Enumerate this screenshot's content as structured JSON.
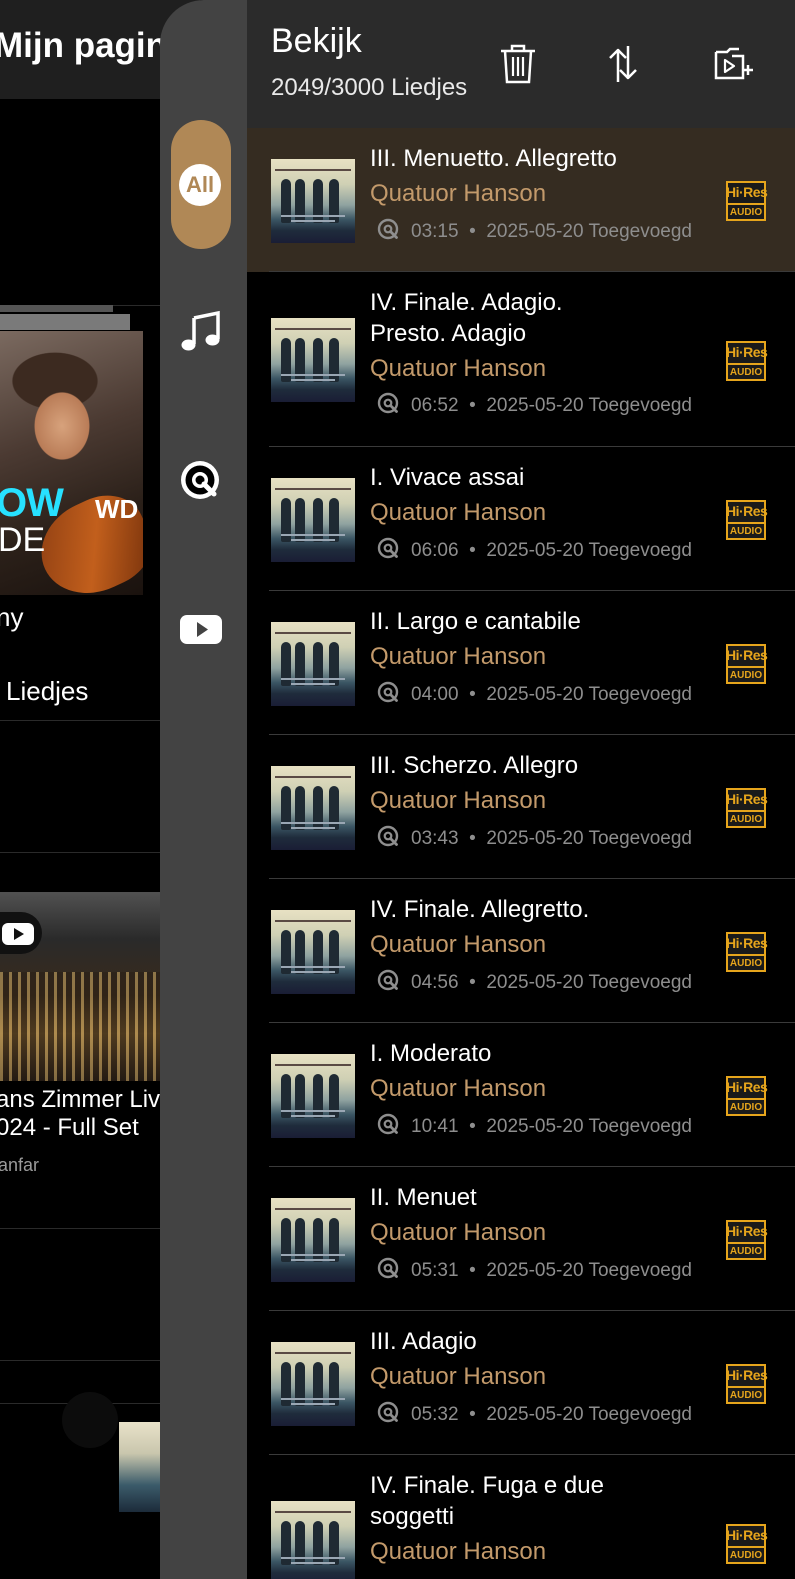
{
  "background_page": {
    "title": "Mijn pagina",
    "cover_text_1": "OW",
    "cover_text_2": "WD",
    "cover_text_3": "DE",
    "label_1": "ny",
    "label_2": "Liedjes",
    "video_title_line1": "ans Zimmer Liv",
    "video_title_line2": "024 - Full Set",
    "video_channel": "anfar"
  },
  "sidebar": {
    "filters": [
      {
        "label": "All",
        "icon": "all-icon"
      },
      {
        "icon": "music-note-icon"
      },
      {
        "icon": "qobuz-icon"
      },
      {
        "icon": "youtube-icon"
      }
    ],
    "selected": "All"
  },
  "panel": {
    "title": "Bekijk",
    "count": "2049/3000 Liedjes",
    "toolbar": [
      "trash-icon",
      "sort-icon",
      "add-to-playlist-icon"
    ],
    "badge": {
      "top": "Hi·Res",
      "bottom": "AUDIO",
      "color": "#e6a51c"
    },
    "accent": "#c39a6b",
    "tracks": [
      {
        "title": "III. Menuetto. Allegretto",
        "artist": "Quatuor Hanson",
        "duration": "03:15",
        "added": "2025-05-20 Toegevoegd"
      },
      {
        "title": "IV. Finale. Adagio. Presto. Adagio",
        "artist": "Quatuor Hanson",
        "duration": "06:52",
        "added": "2025-05-20 Toegevoegd"
      },
      {
        "title": "I. Vivace assai",
        "artist": "Quatuor Hanson",
        "duration": "06:06",
        "added": "2025-05-20 Toegevoegd"
      },
      {
        "title": "II. Largo e cantabile",
        "artist": "Quatuor Hanson",
        "duration": "04:00",
        "added": "2025-05-20 Toegevoegd"
      },
      {
        "title": "III. Scherzo. Allegro",
        "artist": "Quatuor Hanson",
        "duration": "03:43",
        "added": "2025-05-20 Toegevoegd"
      },
      {
        "title": "IV. Finale. Allegretto.",
        "artist": "Quatuor Hanson",
        "duration": "04:56",
        "added": "2025-05-20 Toegevoegd"
      },
      {
        "title": "I. Moderato",
        "artist": "Quatuor Hanson",
        "duration": "10:41",
        "added": "2025-05-20 Toegevoegd"
      },
      {
        "title": "II. Menuet",
        "artist": "Quatuor Hanson",
        "duration": "05:31",
        "added": "2025-05-20 Toegevoegd"
      },
      {
        "title": "III. Adagio",
        "artist": "Quatuor Hanson",
        "duration": "05:32",
        "added": "2025-05-20 Toegevoegd"
      },
      {
        "title": "IV. Finale. Fuga e due soggetti",
        "artist": "Quatuor Hanson",
        "duration": "",
        "added": ""
      }
    ]
  }
}
